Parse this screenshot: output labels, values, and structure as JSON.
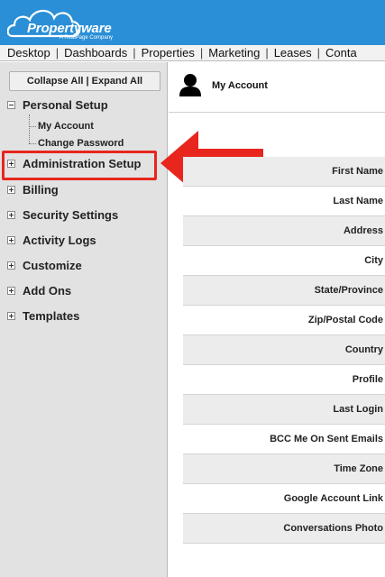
{
  "brand": {
    "name": "Propertyware",
    "tagline": "A RealPage Company",
    "color": "#2a8fd6"
  },
  "nav": {
    "items": [
      "Desktop",
      "Dashboards",
      "Properties",
      "Marketing",
      "Leases",
      "Conta"
    ]
  },
  "sidebar": {
    "collapse_all": "Collapse All",
    "expand_all": "Expand All",
    "sections": [
      {
        "label": "Personal Setup",
        "state": "expanded",
        "children": [
          "My Account",
          "Change Password"
        ]
      },
      {
        "label": "Administration Setup",
        "state": "collapsed",
        "highlighted": true
      },
      {
        "label": "Billing",
        "state": "collapsed"
      },
      {
        "label": "Security Settings",
        "state": "collapsed"
      },
      {
        "label": "Activity Logs",
        "state": "collapsed"
      },
      {
        "label": "Customize",
        "state": "collapsed"
      },
      {
        "label": "Add Ons",
        "state": "collapsed"
      },
      {
        "label": "Templates",
        "state": "collapsed"
      }
    ]
  },
  "main": {
    "title": "My Account",
    "icon": "person-icon",
    "fields": [
      "First Name",
      "Last Name",
      "Address",
      "City",
      "State/Province",
      "Zip/Postal Code",
      "Country",
      "Profile",
      "Last Login",
      "BCC Me On Sent Emails",
      "Time Zone",
      "Google Account Link",
      "Conversations Photo"
    ]
  },
  "annotation": {
    "highlight_color": "#e8261d",
    "points_to": "Administration Setup"
  }
}
